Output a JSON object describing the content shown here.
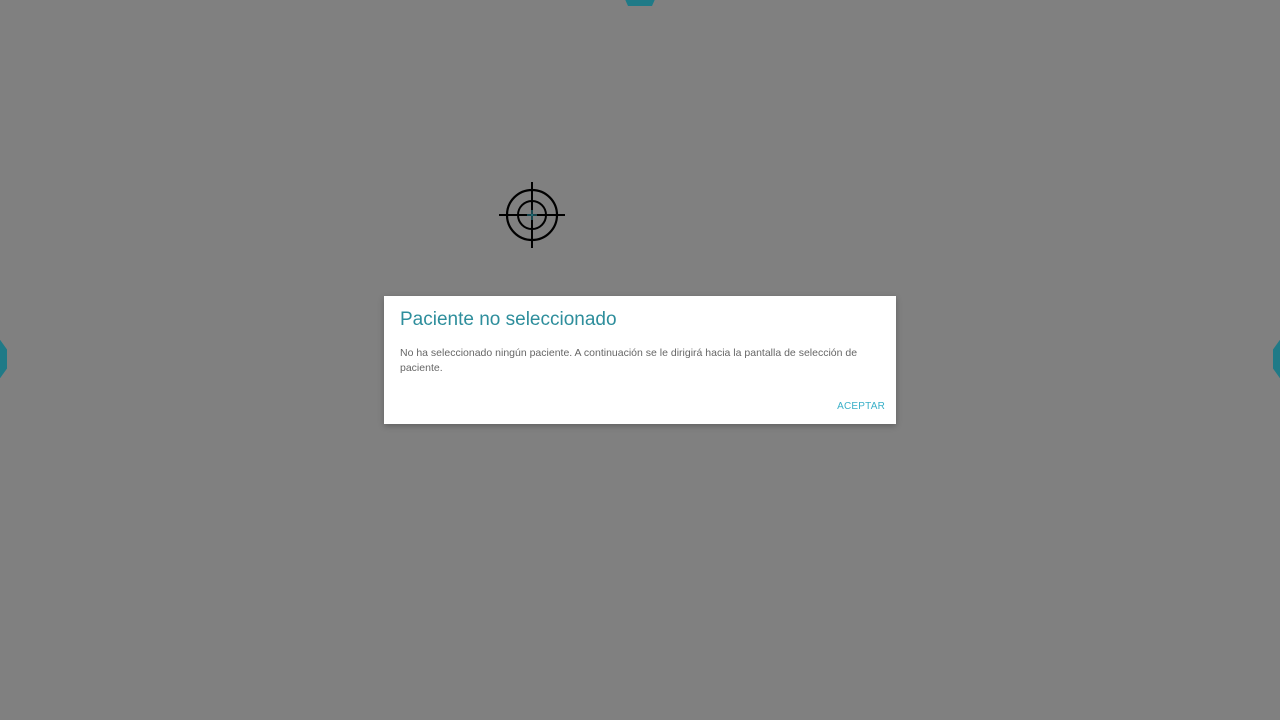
{
  "colors": {
    "overlay_background": "#808080",
    "edge_tab": "#1f7a87",
    "dialog_title": "#2e8e9c",
    "dialog_button": "#3ab0c8"
  },
  "cursor": {
    "icon": "crosshair-target-icon"
  },
  "dialog": {
    "title": "Paciente no seleccionado",
    "message": "No ha seleccionado ningún paciente. A continuación se le dirigirá hacia la pantalla de selección de paciente.",
    "accept_label": "ACEPTAR"
  }
}
